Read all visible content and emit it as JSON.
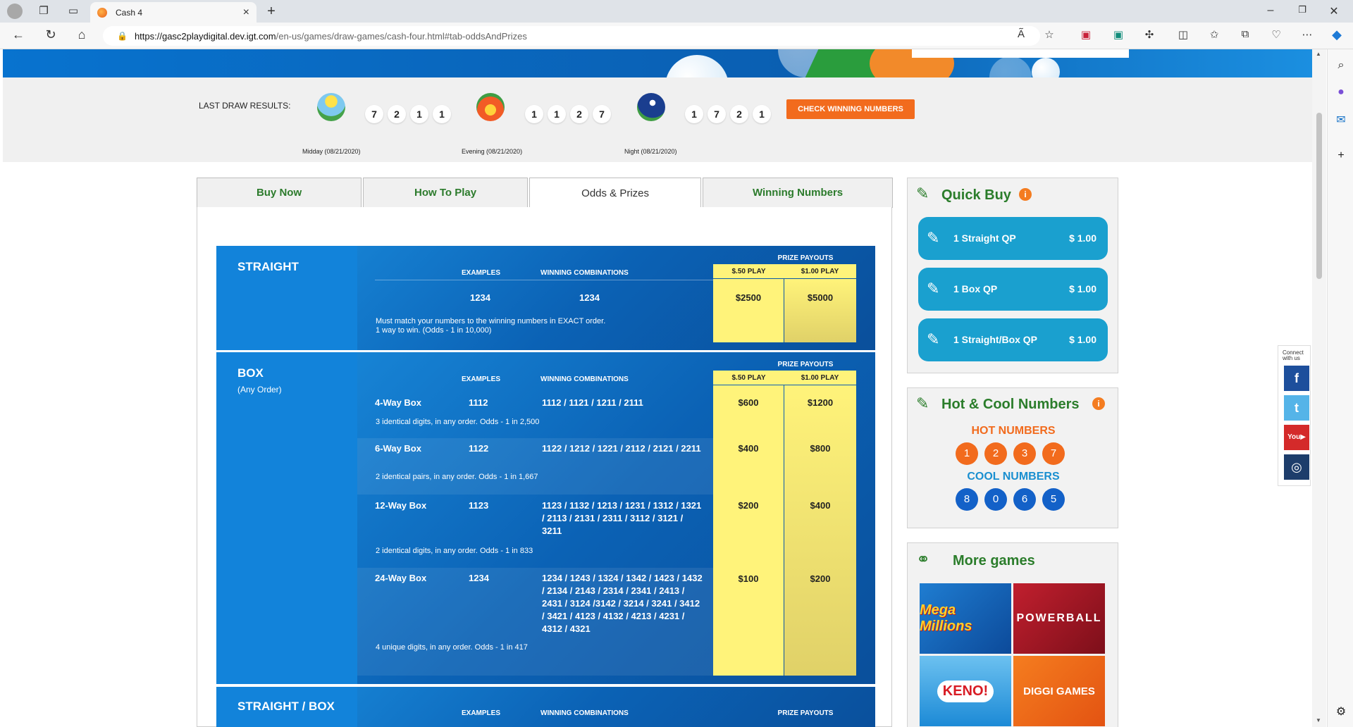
{
  "browser": {
    "tab_title": "Cash 4",
    "url_host": "https://gasc2playdigital.dev.igt.com",
    "url_path": "/en-us/games/draw-games/cash-four.html#tab-oddsAndPrizes"
  },
  "last_draw": {
    "label": "LAST DRAW RESULTS:",
    "draws": [
      {
        "name": "Midday (08/21/2020)",
        "numbers": [
          "7",
          "2",
          "1",
          "1"
        ],
        "icon": "sun-icon"
      },
      {
        "name": "Evening (08/21/2020)",
        "numbers": [
          "1",
          "1",
          "2",
          "7"
        ],
        "icon": "sunset-icon"
      },
      {
        "name": "Night (08/21/2020)",
        "numbers": [
          "1",
          "7",
          "2",
          "1"
        ],
        "icon": "moon-icon"
      }
    ],
    "check_button": "CHECK WINNING NUMBERS"
  },
  "tabs": [
    "Buy Now",
    "How To Play",
    "Odds & Prizes",
    "Winning Numbers"
  ],
  "active_tab": "Odds & Prizes",
  "headers": {
    "examples": "EXAMPLES",
    "winning_combinations": "WINNING COMBINATIONS",
    "prize_payouts": "PRIZE PAYOUTS",
    "play50": "$.50 PLAY",
    "play100": "$1.00 PLAY"
  },
  "straight": {
    "title": "STRAIGHT",
    "example": "1234",
    "combination": "1234",
    "prize50": "$2500",
    "prize100": "$5000",
    "note1": "Must match your numbers to the winning numbers in EXACT order.",
    "note2": "1 way to win. (Odds - 1 in 10,000)"
  },
  "box": {
    "title": "BOX",
    "subtitle": "(Any Order)",
    "rows": [
      {
        "name": "4-Way Box",
        "example": "1112",
        "combos": "1112 / 1121 / 1211 / 2111",
        "prize50": "$600",
        "prize100": "$1200",
        "note": "3 identical digits, in any order. Odds - 1 in 2,500"
      },
      {
        "name": "6-Way Box",
        "example": "1122",
        "combos": "1122 / 1212 / 1221 / 2112 / 2121 / 2211",
        "prize50": "$400",
        "prize100": "$800",
        "note": "2 identical pairs, in any order. Odds - 1 in 1,667"
      },
      {
        "name": "12-Way Box",
        "example": "1123",
        "combos": "1123 / 1132 / 1213 / 1231 / 1312 / 1321 / 2113 / 2131 / 2311 / 3112 / 3121 / 3211",
        "prize50": "$200",
        "prize100": "$400",
        "note": "2 identical digits, in any order. Odds - 1 in 833"
      },
      {
        "name": "24-Way Box",
        "example": "1234",
        "combos": "1234 / 1243 / 1324 / 1342 / 1423 / 1432 / 2134 / 2143 / 2314 / 2341 / 2413 / 2431 / 3124 /3142 / 3214 / 3241 / 3412 / 3421 / 4123 / 4132 / 4213 / 4231 / 4312 / 4321",
        "prize50": "$100",
        "prize100": "$200",
        "note": "4 unique digits, in any order. Odds - 1 in 417"
      }
    ]
  },
  "straight_box": {
    "title": "STRAIGHT / BOX"
  },
  "quick_buy": {
    "title": "Quick Buy",
    "items": [
      {
        "label": "1 Straight QP",
        "price": "$ 1.00"
      },
      {
        "label": "1 Box QP",
        "price": "$ 1.00"
      },
      {
        "label": "1 Straight/Box QP",
        "price": "$ 1.00"
      }
    ]
  },
  "hot_cool": {
    "title": "Hot & Cool Numbers",
    "hot_label": "HOT NUMBERS",
    "hot": [
      "1",
      "2",
      "3",
      "7"
    ],
    "cool_label": "COOL NUMBERS",
    "cool": [
      "8",
      "0",
      "6",
      "5"
    ]
  },
  "more_games": {
    "title": "More games",
    "games": [
      "Mega Millions",
      "POWERBALL",
      "KENO!",
      "DIGGI GAMES"
    ]
  },
  "social": {
    "label": "Connect with us",
    "icons": [
      "facebook-icon",
      "twitter-icon",
      "youtube-icon",
      "instagram-icon"
    ]
  },
  "colors": {
    "accent_green": "#2b7d2b",
    "orange": "#f26b1d",
    "blue": "#1283da",
    "yellow": "#fff37a"
  }
}
